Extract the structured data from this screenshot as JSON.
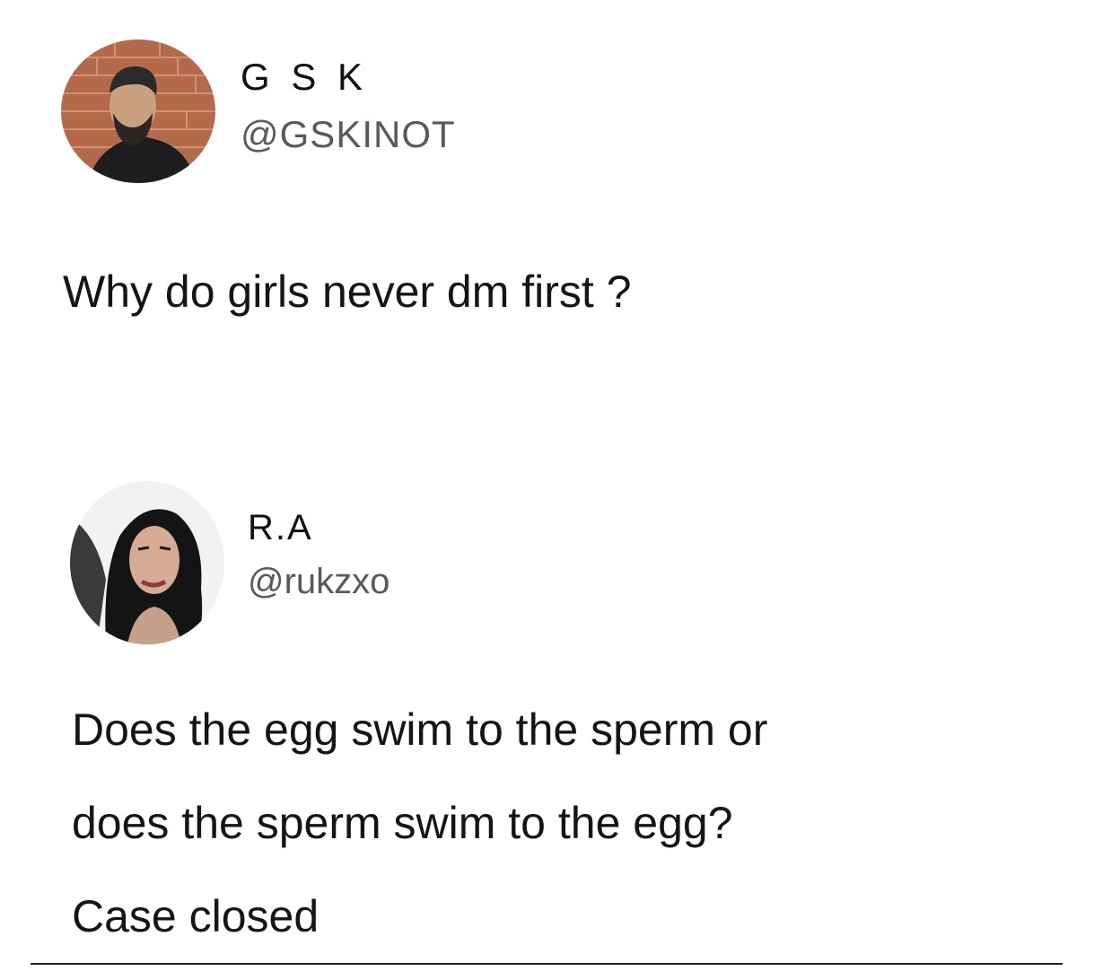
{
  "tweets": [
    {
      "display_name": "G S K",
      "handle": "@GSKINOT",
      "avatar_icon": "profile-photo-man-brick-wall",
      "text": "Why do girls never dm first ?"
    },
    {
      "display_name": "R.A",
      "handle": "@rukzxo",
      "avatar_icon": "profile-photo-woman",
      "text_lines": [
        "Does the egg swim to the sperm or",
        "does the sperm swim to the egg?",
        "Case closed"
      ]
    }
  ],
  "colors": {
    "background": "#ffffff",
    "text": "#151515",
    "handle": "#5a5a5a"
  }
}
